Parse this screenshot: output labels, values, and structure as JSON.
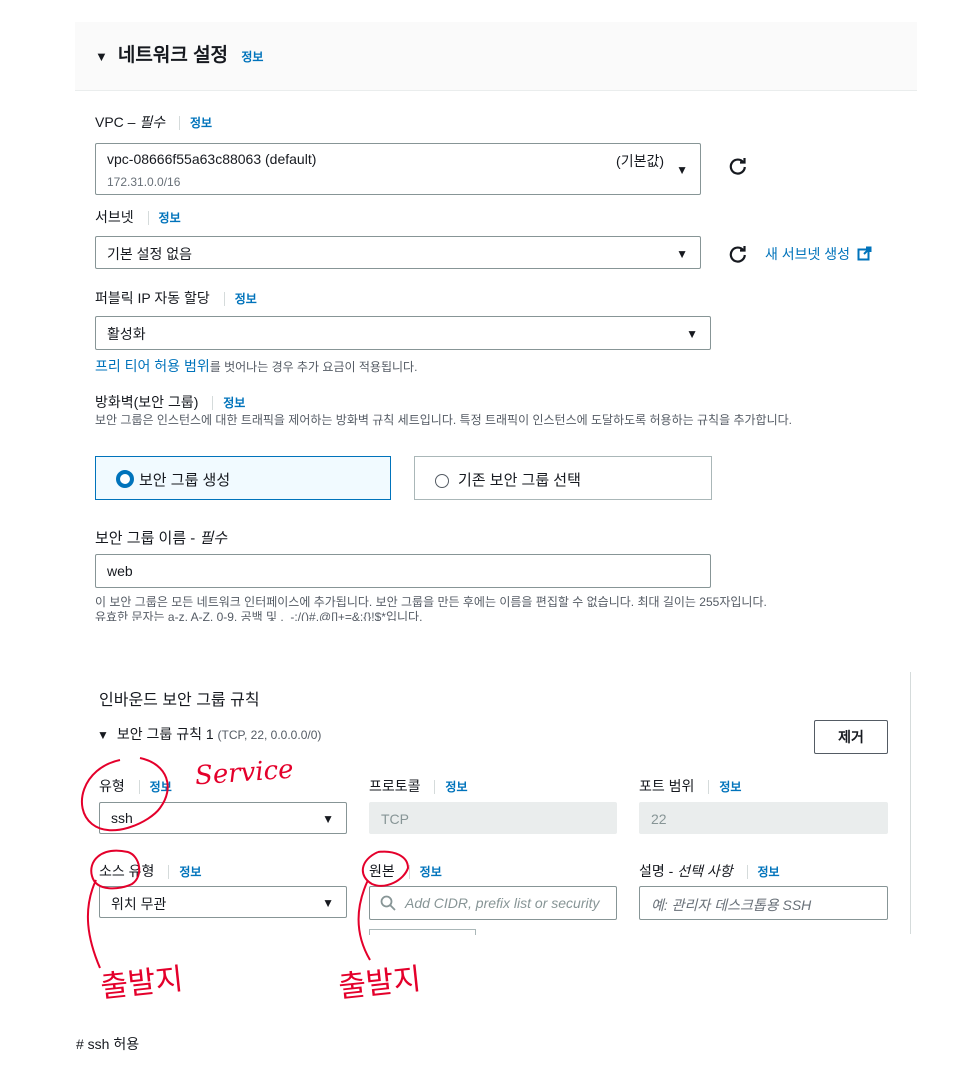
{
  "network": {
    "title": "네트워크 설정",
    "info": "정보",
    "vpc": {
      "label": "VPC – ",
      "required": "필수",
      "info": "정보",
      "value": "vpc-08666f55a63c88063 (default)",
      "subvalue": "172.31.0.0/16",
      "tag": "(기본값)"
    },
    "subnet": {
      "label": "서브넷",
      "info": "정보",
      "value": "기본 설정 없음",
      "create_link": "새 서브넷 생성"
    },
    "public_ip": {
      "label": "퍼블릭 IP 자동 할당",
      "info": "정보",
      "value": "활성화",
      "note_link": "프리 티어 허용 범위",
      "note_text": "를 벗어나는 경우 추가 요금이 적용됩니다."
    },
    "firewall": {
      "label": "방화벽(보안 그룹)",
      "info": "정보",
      "description": "보안 그룹은 인스턴스에 대한 트래픽을 제어하는 방화벽 규칙 세트입니다. 특정 트래픽이 인스턴스에 도달하도록 허용하는 규칙을 추가합니다.",
      "option_create": "보안 그룹 생성",
      "option_existing": "기존 보안 그룹 선택",
      "selected": "보안 그룹 생성"
    },
    "sg_name": {
      "label": "보안 그룹 이름 - ",
      "required": "필수",
      "value": "web",
      "hint1": "이 보안 그룹은 모든 네트워크 인터페이스에 추가됩니다. 보안 그룹을 만든 후에는 이름을 편집할 수 없습니다. 최대 길이는 255자입니다.",
      "hint2": "유효한 문자는 a-z, A-Z, 0-9, 공백 및 ._-:/()#,@[]+=&;{}!$*입니다."
    }
  },
  "inbound": {
    "title": "인바운드 보안 그룹 규칙",
    "rule_title": "보안 그룹 규칙 1",
    "rule_detail": "(TCP, 22, 0.0.0.0/0)",
    "remove_button": "제거",
    "type": {
      "label": "유형",
      "info": "정보",
      "value": "ssh"
    },
    "protocol": {
      "label": "프로토콜",
      "info": "정보",
      "value": "TCP"
    },
    "port": {
      "label": "포트 범위",
      "info": "정보",
      "value": "22"
    },
    "source_type": {
      "label": "소스 유형",
      "info": "정보",
      "value": "위치 무관"
    },
    "source": {
      "label": "원본",
      "info": "정보",
      "placeholder": "Add CIDR, prefix list or security"
    },
    "description": {
      "label": "설명 - ",
      "optional": "선택 사항",
      "info": "정보",
      "placeholder": "예: 관리자 데스크톱용 SSH"
    }
  },
  "annotations": {
    "service": "Service",
    "left_note": "출발지",
    "right_note": "출발지",
    "caption": "# ssh 허용"
  },
  "colors": {
    "accent": "#0073bb",
    "annotation": "#e4002b"
  },
  "icons": [
    "caret-down-icon",
    "refresh-icon",
    "external-link-icon",
    "search-icon",
    "radio-selected-icon",
    "radio-unselected-icon"
  ]
}
